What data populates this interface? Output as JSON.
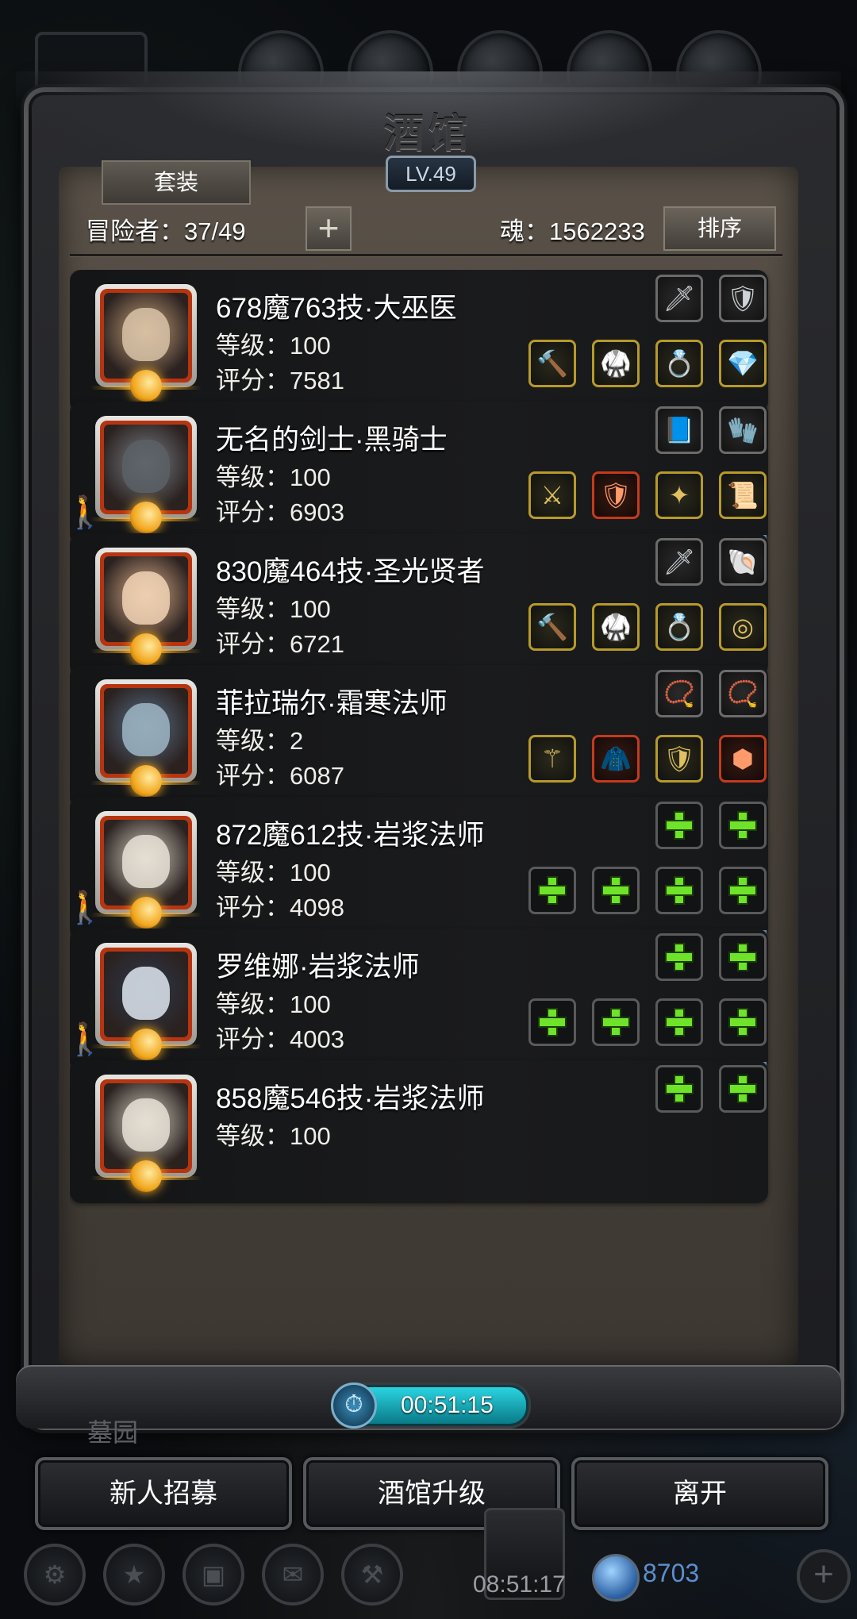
{
  "title": "酒馆",
  "level_badge": "LV.49",
  "tab_set": "套装",
  "adventurers_label": "冒险者：37/49",
  "soul_label": "魂：1562233",
  "sort_label": "排序",
  "timer": "00:51:15",
  "cemetery_label": "墓园",
  "buttons": {
    "recruit": "新人招募",
    "upgrade": "酒馆升级",
    "leave": "离开"
  },
  "hud": {
    "clock": "08:51:17",
    "gems": "8703"
  },
  "heroes": [
    {
      "name": "678魔763技·大巫医",
      "level": "等级：100",
      "score": "评分：7581",
      "moving": false,
      "ribbons": [],
      "top_slots": [
        {
          "type": "gray",
          "icon": "dagger-icon",
          "glyph": "🗡"
        },
        {
          "type": "gray",
          "icon": "bracer-icon",
          "glyph": "🛡"
        }
      ],
      "bottom_slots": [
        {
          "type": "gold",
          "icon": "mace-icon",
          "glyph": "🔨"
        },
        {
          "type": "gold",
          "icon": "armor-icon",
          "glyph": "🥋"
        },
        {
          "type": "gold",
          "icon": "ring-icon",
          "glyph": "💍"
        },
        {
          "type": "gold",
          "icon": "gem-icon",
          "glyph": "💎"
        }
      ]
    },
    {
      "name": "无名的剑士·黑骑士",
      "level": "等级：100",
      "score": "评分：6903",
      "moving": true,
      "ribbons": [
        "1"
      ],
      "top_slots": [
        {
          "type": "gray",
          "icon": "book-icon",
          "glyph": "📘"
        },
        {
          "type": "gray",
          "icon": "gauntlet-icon",
          "glyph": "🧤"
        }
      ],
      "bottom_slots": [
        {
          "type": "gold",
          "icon": "sword-icon",
          "glyph": "⚔"
        },
        {
          "type": "red",
          "icon": "plate-armor-icon",
          "glyph": "🛡"
        },
        {
          "type": "gold",
          "icon": "amulet-icon",
          "glyph": "✦"
        },
        {
          "type": "gold",
          "icon": "scroll-icon",
          "glyph": "📜"
        }
      ]
    },
    {
      "name": "830魔464技·圣光贤者",
      "level": "等级：100",
      "score": "评分：6721",
      "moving": false,
      "ribbons": [],
      "top_slots": [
        {
          "type": "gray",
          "icon": "dagger-icon",
          "glyph": "🗡"
        },
        {
          "type": "gray",
          "icon": "horn-icon",
          "glyph": "🐚"
        }
      ],
      "bottom_slots": [
        {
          "type": "gold",
          "icon": "hammer-icon",
          "glyph": "🔨"
        },
        {
          "type": "gold",
          "icon": "armor-icon",
          "glyph": "🥋"
        },
        {
          "type": "gold",
          "icon": "ring-icon",
          "glyph": "💍"
        },
        {
          "type": "gold",
          "icon": "bracelet-icon",
          "glyph": "◎"
        }
      ]
    },
    {
      "name": "菲拉瑞尔·霜寒法师",
      "level": "等级：2",
      "score": "评分：6087",
      "moving": false,
      "ribbons": [],
      "top_slots": [
        {
          "type": "gray",
          "icon": "necklace-icon",
          "glyph": "📿"
        },
        {
          "type": "gray",
          "icon": "necklace-icon",
          "glyph": "📿"
        }
      ],
      "bottom_slots": [
        {
          "type": "gold",
          "icon": "staff-icon",
          "glyph": "⚚"
        },
        {
          "type": "red",
          "icon": "robe-icon",
          "glyph": "🧥"
        },
        {
          "type": "gold",
          "icon": "bracer-icon",
          "glyph": "🛡"
        },
        {
          "type": "red",
          "icon": "orb-icon",
          "glyph": "⬢"
        }
      ]
    },
    {
      "name": "872魔612技·岩浆法师",
      "level": "等级：100",
      "score": "评分：4098",
      "moving": true,
      "ribbons": [
        "1"
      ],
      "top_slots": [
        {
          "type": "empty",
          "icon": "add-icon"
        },
        {
          "type": "empty",
          "icon": "add-icon"
        }
      ],
      "bottom_slots": [
        {
          "type": "empty",
          "icon": "add-icon"
        },
        {
          "type": "empty",
          "icon": "add-icon"
        },
        {
          "type": "empty",
          "icon": "add-icon"
        },
        {
          "type": "empty",
          "icon": "add-icon"
        }
      ]
    },
    {
      "name": "罗维娜·岩浆法师",
      "level": "等级：100",
      "score": "评分：4003",
      "moving": true,
      "ribbons": [
        "3",
        "2"
      ],
      "top_slots": [
        {
          "type": "empty",
          "icon": "add-icon"
        },
        {
          "type": "empty",
          "icon": "add-icon"
        }
      ],
      "bottom_slots": [
        {
          "type": "empty",
          "icon": "add-icon"
        },
        {
          "type": "empty",
          "icon": "add-icon"
        },
        {
          "type": "empty",
          "icon": "add-icon"
        },
        {
          "type": "empty",
          "icon": "add-icon"
        }
      ]
    },
    {
      "name": "858魔546技·岩浆法师",
      "level": "等级：100",
      "score": "",
      "moving": false,
      "ribbons": [],
      "top_slots": [
        {
          "type": "empty",
          "icon": "add-icon"
        },
        {
          "type": "empty",
          "icon": "add-icon"
        }
      ],
      "bottom_slots": []
    }
  ]
}
